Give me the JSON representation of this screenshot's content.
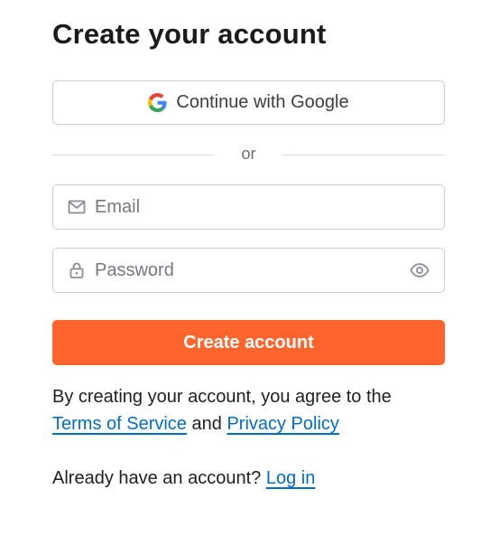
{
  "title": "Create your account",
  "google_button": {
    "label": "Continue with Google",
    "icon": "google-g-icon"
  },
  "divider_text": "or",
  "email_field": {
    "placeholder": "Email",
    "value": "",
    "icon": "mail-icon"
  },
  "password_field": {
    "placeholder": "Password",
    "value": "",
    "icon": "lock-icon",
    "toggle_icon": "eye-icon"
  },
  "submit_button": {
    "label": "Create account"
  },
  "terms": {
    "prefix": "By creating your account, you agree to the",
    "terms_link": "Terms of Service",
    "conjunction": "and",
    "privacy_link": "Privacy Policy"
  },
  "login": {
    "prompt": "Already have an account?",
    "link": "Log in"
  },
  "colors": {
    "accent": "#ff642d",
    "link": "#006dca",
    "border": "#c9ccd3"
  }
}
